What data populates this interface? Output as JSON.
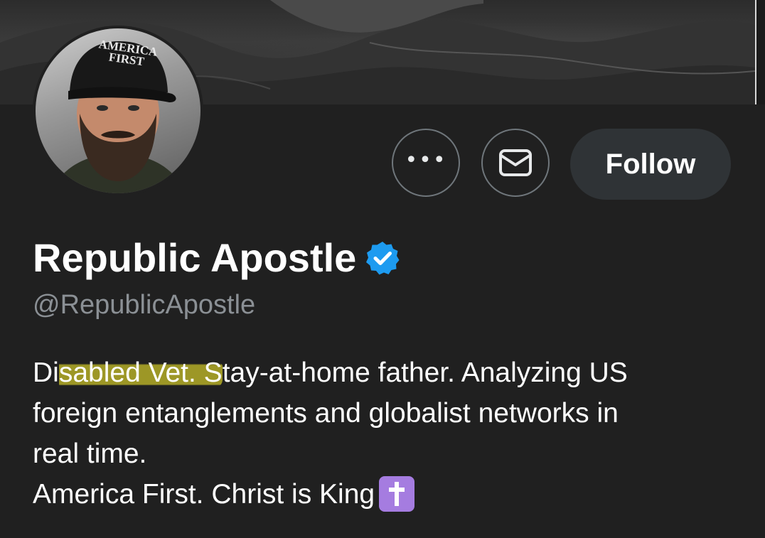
{
  "profile": {
    "display_name": "Republic Apostle",
    "handle": "@RepublicApostle",
    "verified": true,
    "hat_text_line1": "AMERICA",
    "hat_text_line2": "FIRST"
  },
  "actions": {
    "more_label": "•••",
    "message_icon": "envelope-icon",
    "follow_label": "Follow"
  },
  "bio": {
    "line1_pre": "Di",
    "line1_highlight": "sabled Vet. S",
    "line1_post": "tay-at-home father. Analyzing US",
    "line2": "foreign entanglements and globalist networks in",
    "line3": "real time.",
    "line4": "America First. Christ is King",
    "emoji": "cross-icon"
  },
  "colors": {
    "background": "#202020",
    "follow_button": "#2f3336",
    "verified_badge": "#1d9bf0",
    "handle_text": "#8b9095",
    "highlight": "#c7bf28",
    "emoji_bg": "#a57ce0"
  }
}
